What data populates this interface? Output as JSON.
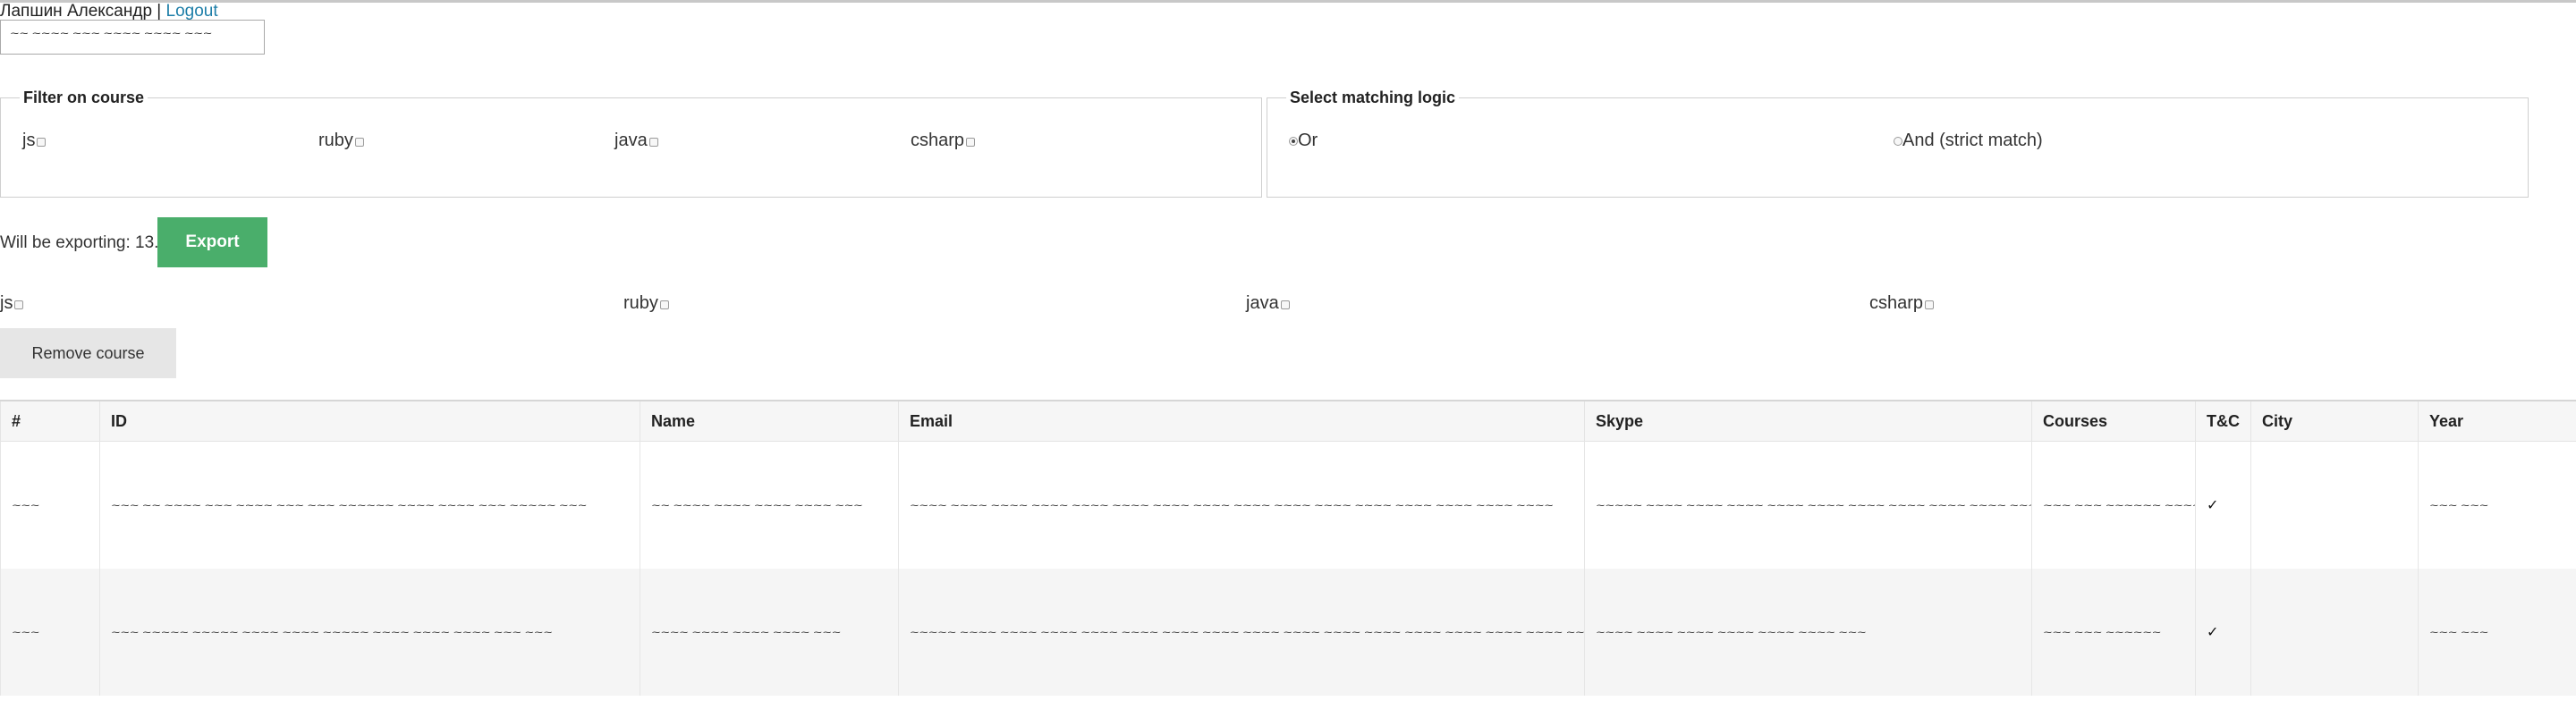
{
  "header": {
    "user_name": "Лапшин Александр",
    "separator": " | ",
    "logout_label": "Logout"
  },
  "search": {
    "value": "~~ ~~~~ ~~~ ~~~~ ~~~~ ~~~"
  },
  "filter": {
    "title": "Filter on course",
    "courses": [
      "js",
      "ruby",
      "java",
      "csharp"
    ]
  },
  "logic": {
    "title": "Select matching logic",
    "options": [
      {
        "label": "Or",
        "selected": true
      },
      {
        "label": "And (strict match)",
        "selected": false
      }
    ]
  },
  "export": {
    "text": "Will be exporting: 13.",
    "button_label": "Export",
    "button_color": "#4aae6b"
  },
  "remove": {
    "courses": [
      "js",
      "ruby",
      "java",
      "csharp"
    ],
    "button_label": "Remove course"
  },
  "table": {
    "headers": [
      "#",
      "ID",
      "Name",
      "Email",
      "Skype",
      "Courses",
      "T&C",
      "City",
      "Year"
    ],
    "rows": [
      {
        "num": "~~~",
        "id": "~~~ ~~ ~~~~ ~~~ ~~~~ ~~~ ~~~ ~~~~~~ ~~~~ ~~~~ ~~~ ~~~~~ ~~~",
        "name": "~~ ~~~~ ~~~~ ~~~~ ~~~~ ~~~",
        "email": "~~~~ ~~~~ ~~~~ ~~~~ ~~~~ ~~~~ ~~~~ ~~~~ ~~~~ ~~~~ ~~~~ ~~~~ ~~~~ ~~~~ ~~~~ ~~~~",
        "skype": "~~~~~ ~~~~ ~~~~ ~~~~ ~~~~ ~~~~ ~~~~ ~~~~ ~~~~ ~~~~ ~~~~ ~~~",
        "courses": "~~~ ~~~ ~~~~~~ ~~~~",
        "tc": "✓",
        "city": "",
        "year": "~~~ ~~~"
      },
      {
        "num": "~~~",
        "id": "~~~ ~~~~~ ~~~~~ ~~~~ ~~~~ ~~~~~ ~~~~ ~~~~ ~~~~ ~~~ ~~~",
        "name": "~~~~ ~~~~ ~~~~ ~~~~ ~~~",
        "email": "~~~~~ ~~~~ ~~~~ ~~~~ ~~~~ ~~~~ ~~~~ ~~~~ ~~~~ ~~~~ ~~~~ ~~~~ ~~~~ ~~~~ ~~~~ ~~~~ ~~~",
        "skype": "~~~~ ~~~~ ~~~~ ~~~~ ~~~~ ~~~~ ~~~",
        "courses": "~~~ ~~~ ~~~~~~",
        "tc": "✓",
        "city": "",
        "year": "~~~ ~~~"
      }
    ]
  }
}
